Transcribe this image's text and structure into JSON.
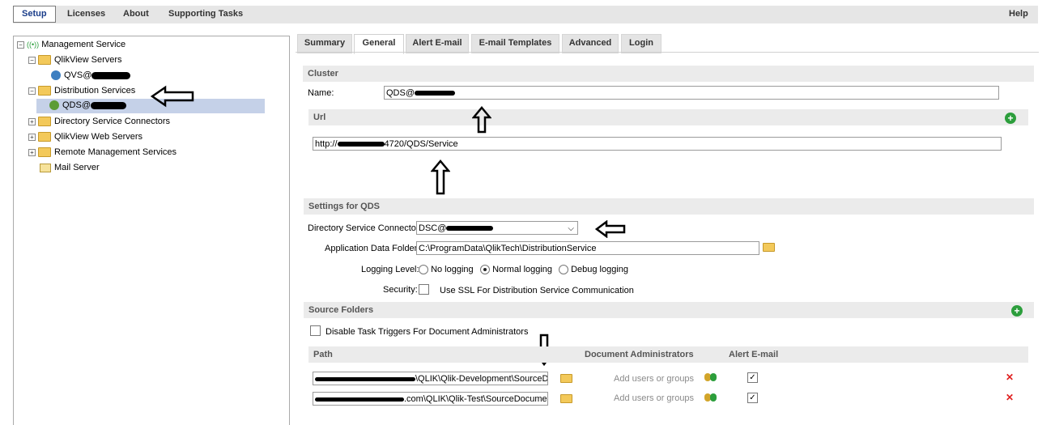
{
  "menu": {
    "setup": "Setup",
    "licenses": "Licenses",
    "about": "About",
    "supporting_tasks": "Supporting Tasks",
    "help": "Help"
  },
  "tree": {
    "management_service": "Management Service",
    "qlikview_servers": "QlikView Servers",
    "qvs_node": "QVS@",
    "distribution_services": "Distribution Services",
    "qds_node": "QDS@",
    "directory_service_connectors": "Directory Service Connectors",
    "qlikview_web_servers": "QlikView Web Servers",
    "remote_management_services": "Remote Management Services",
    "mail_server": "Mail Server"
  },
  "tabs": {
    "summary": "Summary",
    "general": "General",
    "alert_email": "Alert E-mail",
    "email_templates": "E-mail Templates",
    "advanced": "Advanced",
    "login": "Login"
  },
  "cluster": {
    "header": "Cluster",
    "name_label": "Name:",
    "name_value": "QDS@"
  },
  "url": {
    "header": "Url",
    "prefix": "http://",
    "suffix": "4720/QDS/Service"
  },
  "settings": {
    "header": "Settings for QDS",
    "dsc_label": "Directory Service Connector:",
    "dsc_value": "DSC@",
    "app_folder_label": "Application Data Folder:",
    "app_folder_value": "C:\\ProgramData\\QlikTech\\DistributionService",
    "logging_label": "Logging Level:",
    "no_logging": "No logging",
    "normal_logging": "Normal logging",
    "debug_logging": "Debug logging",
    "security_label": "Security:",
    "ssl_label": "Use SSL For Distribution Service Communication"
  },
  "source_folders": {
    "header": "Source Folders",
    "disable_triggers": "Disable Task Triggers For Document Administrators",
    "col_path": "Path",
    "col_doc_admins": "Document Administrators",
    "col_alert": "Alert E-mail",
    "rows": [
      {
        "path_suffix": "\\QLIK\\Qlik-Development\\SourceDo",
        "admins_placeholder": "Add users or groups"
      },
      {
        "path_suffix": ".com\\QLIK\\Qlik-Test\\SourceDocuments",
        "admins_placeholder": "Add users or groups"
      }
    ]
  },
  "colors": {
    "selected_row": "#c5d1e8",
    "section_bg": "#ebebeb",
    "add_green": "#2c9e3c",
    "delete_red": "#e02020"
  }
}
